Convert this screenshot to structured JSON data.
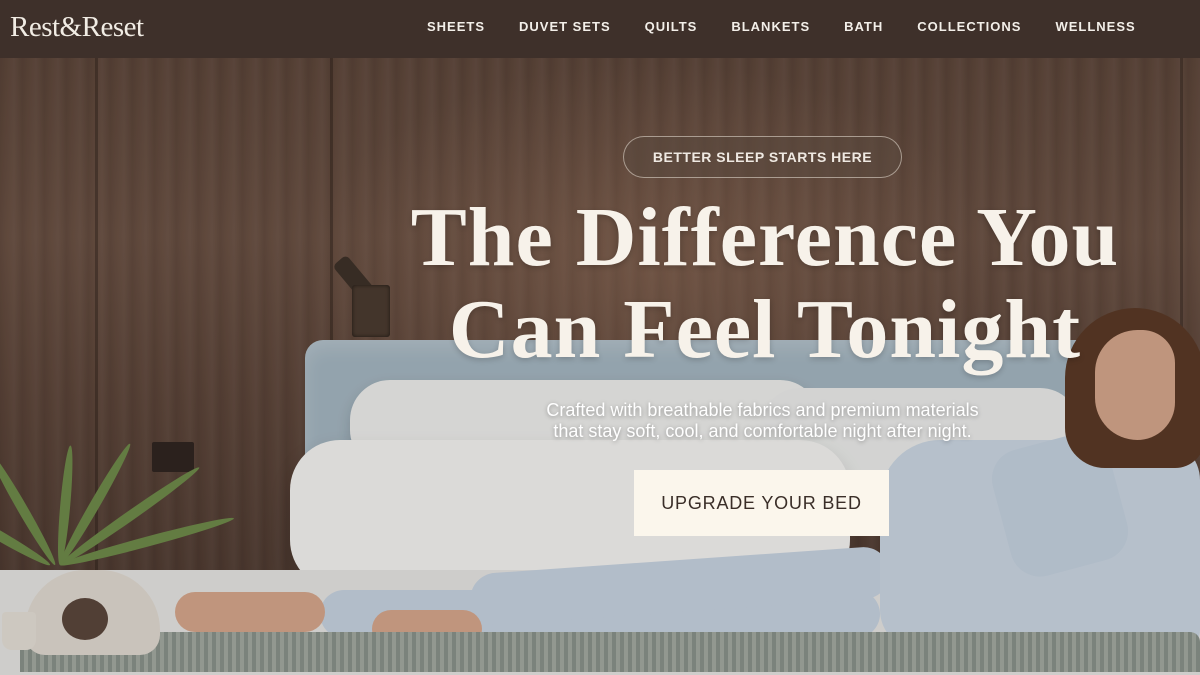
{
  "brand": {
    "logo": "Rest&Reset"
  },
  "nav": {
    "items": [
      {
        "label": "SHEETS"
      },
      {
        "label": "DUVET SETS"
      },
      {
        "label": "QUILTS"
      },
      {
        "label": "BLANKETS"
      },
      {
        "label": "BATH"
      },
      {
        "label": "COLLECTIONS"
      },
      {
        "label": "WELLNESS"
      }
    ]
  },
  "hero": {
    "eyebrow": "BETTER SLEEP STARTS HERE",
    "headline_line1": "The Difference You",
    "headline_line2": "Can Feel Tonight",
    "subhead_line1": "Crafted with breathable fabrics and premium materials",
    "subhead_line2": "that stay soft, cool, and comfortable night after night.",
    "cta_label": "UPGRADE YOUR BED"
  },
  "colors": {
    "navbar_bg": "#3e302a",
    "cta_bg": "#fbf6ec",
    "text_light": "#f7f2ea"
  }
}
